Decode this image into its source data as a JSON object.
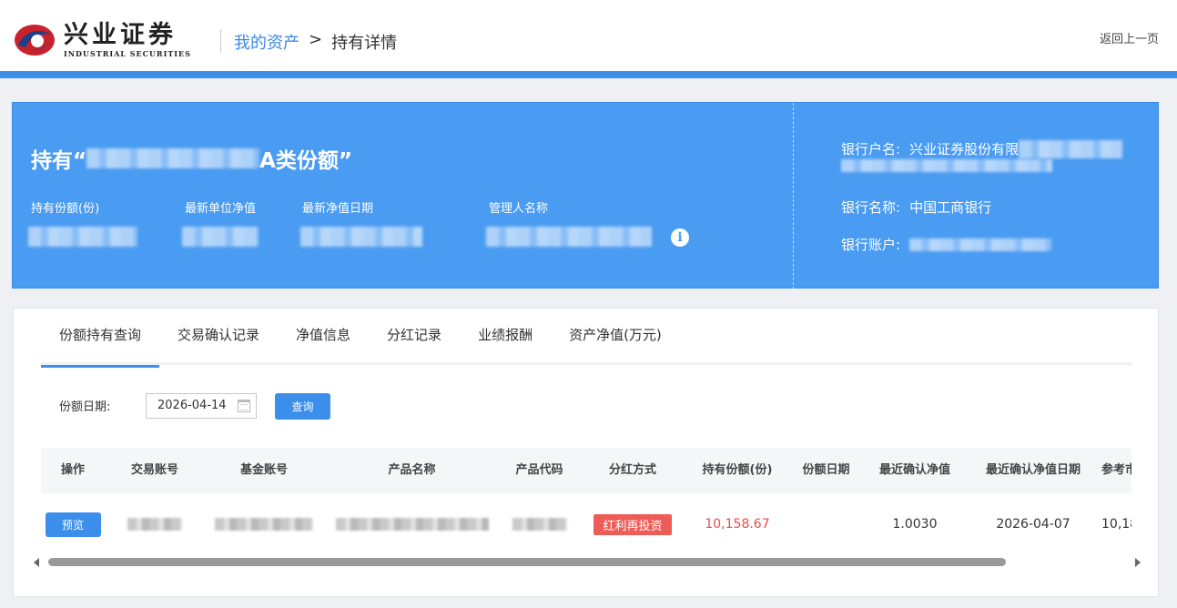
{
  "header": {
    "logo_cn": "兴业证券",
    "logo_en": "INDUSTRIAL SECURITIES",
    "breadcrumb_parent": "我的资产",
    "breadcrumb_sep": ">",
    "breadcrumb_current": "持有详情",
    "back_label": "返回上一页"
  },
  "hero": {
    "title_prefix": "持有“",
    "title_suffix": "A类份额”",
    "labels": {
      "shares": "持有份额(份)",
      "nav": "最新单位净值",
      "nav_date": "最新净值日期",
      "manager": "管理人名称"
    },
    "info_icon": "i",
    "bank_account_name_label": "银行户名:",
    "bank_account_name_value": "兴业证券股份有限",
    "bank_name_label": "银行名称:",
    "bank_name_value": "中国工商银行",
    "bank_account_label": "银行账户:"
  },
  "tabs": [
    "份额持有查询",
    "交易确认记录",
    "净值信息",
    "分红记录",
    "业绩报酬",
    "资产净值(万元)"
  ],
  "active_tab": 0,
  "filter": {
    "label": "份额日期:",
    "date_value": "2026-04-14",
    "query_label": "查询"
  },
  "table": {
    "columns": [
      "操作",
      "交易账号",
      "基金账号",
      "产品名称",
      "产品代码",
      "分红方式",
      "持有份额(份)",
      "份额日期",
      "最近确认净值",
      "最近确认净值日期",
      "参考市"
    ],
    "rows": [
      {
        "action": "预览",
        "dividend": "红利再投资",
        "shares": "10,158.67",
        "share_date": "",
        "confirmed_nav": "1.0030",
        "confirmed_nav_date": "2026-04-07",
        "market_value": "10,18"
      }
    ]
  },
  "colors": {
    "accent": "#3b8eea",
    "hero_bg": "#4a9bf2",
    "red": "#ee4b45",
    "badge": "#ee5c57"
  },
  "icons": [
    "logo-mark-icon",
    "info-icon",
    "calendar-icon",
    "scroll-left-icon",
    "scroll-right-icon"
  ]
}
